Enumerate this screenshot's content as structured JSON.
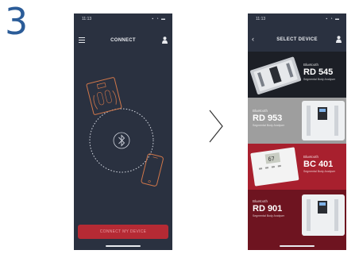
{
  "step": {
    "number": "3"
  },
  "connect_screen": {
    "status_time": "11:13",
    "title": "CONNECT",
    "connect_button_label": "CONNECT MY DEVICE"
  },
  "select_screen": {
    "status_time": "11:13",
    "title": "SELECT DEVICE",
    "devices": [
      {
        "bluetooth_label": "Bluetooth",
        "model": "RD 545",
        "description": "Segmental Body Analyser",
        "color": "#1c1f26"
      },
      {
        "bluetooth_label": "Bluetooth",
        "model": "RD 953",
        "description": "Segmental Body Analyser",
        "color": "#9e9e9e"
      },
      {
        "bluetooth_label": "Bluetooth",
        "model": "BC 401",
        "description": "Segmental Body Analyser",
        "color": "#a8202e"
      },
      {
        "bluetooth_label": "Bluetooth",
        "model": "RD 901",
        "description": "Segmental Body Analyser",
        "color": "#6e1420"
      }
    ]
  },
  "colors": {
    "accent": "#2b5c98",
    "button": "#b52a34",
    "screen_bg": "#2a3140",
    "line_art": "#d0774a"
  },
  "icons": [
    "menu-icon",
    "user-icon",
    "bluetooth-icon",
    "scale-icon",
    "phone-icon",
    "chevron-right-icon",
    "back-icon"
  ]
}
